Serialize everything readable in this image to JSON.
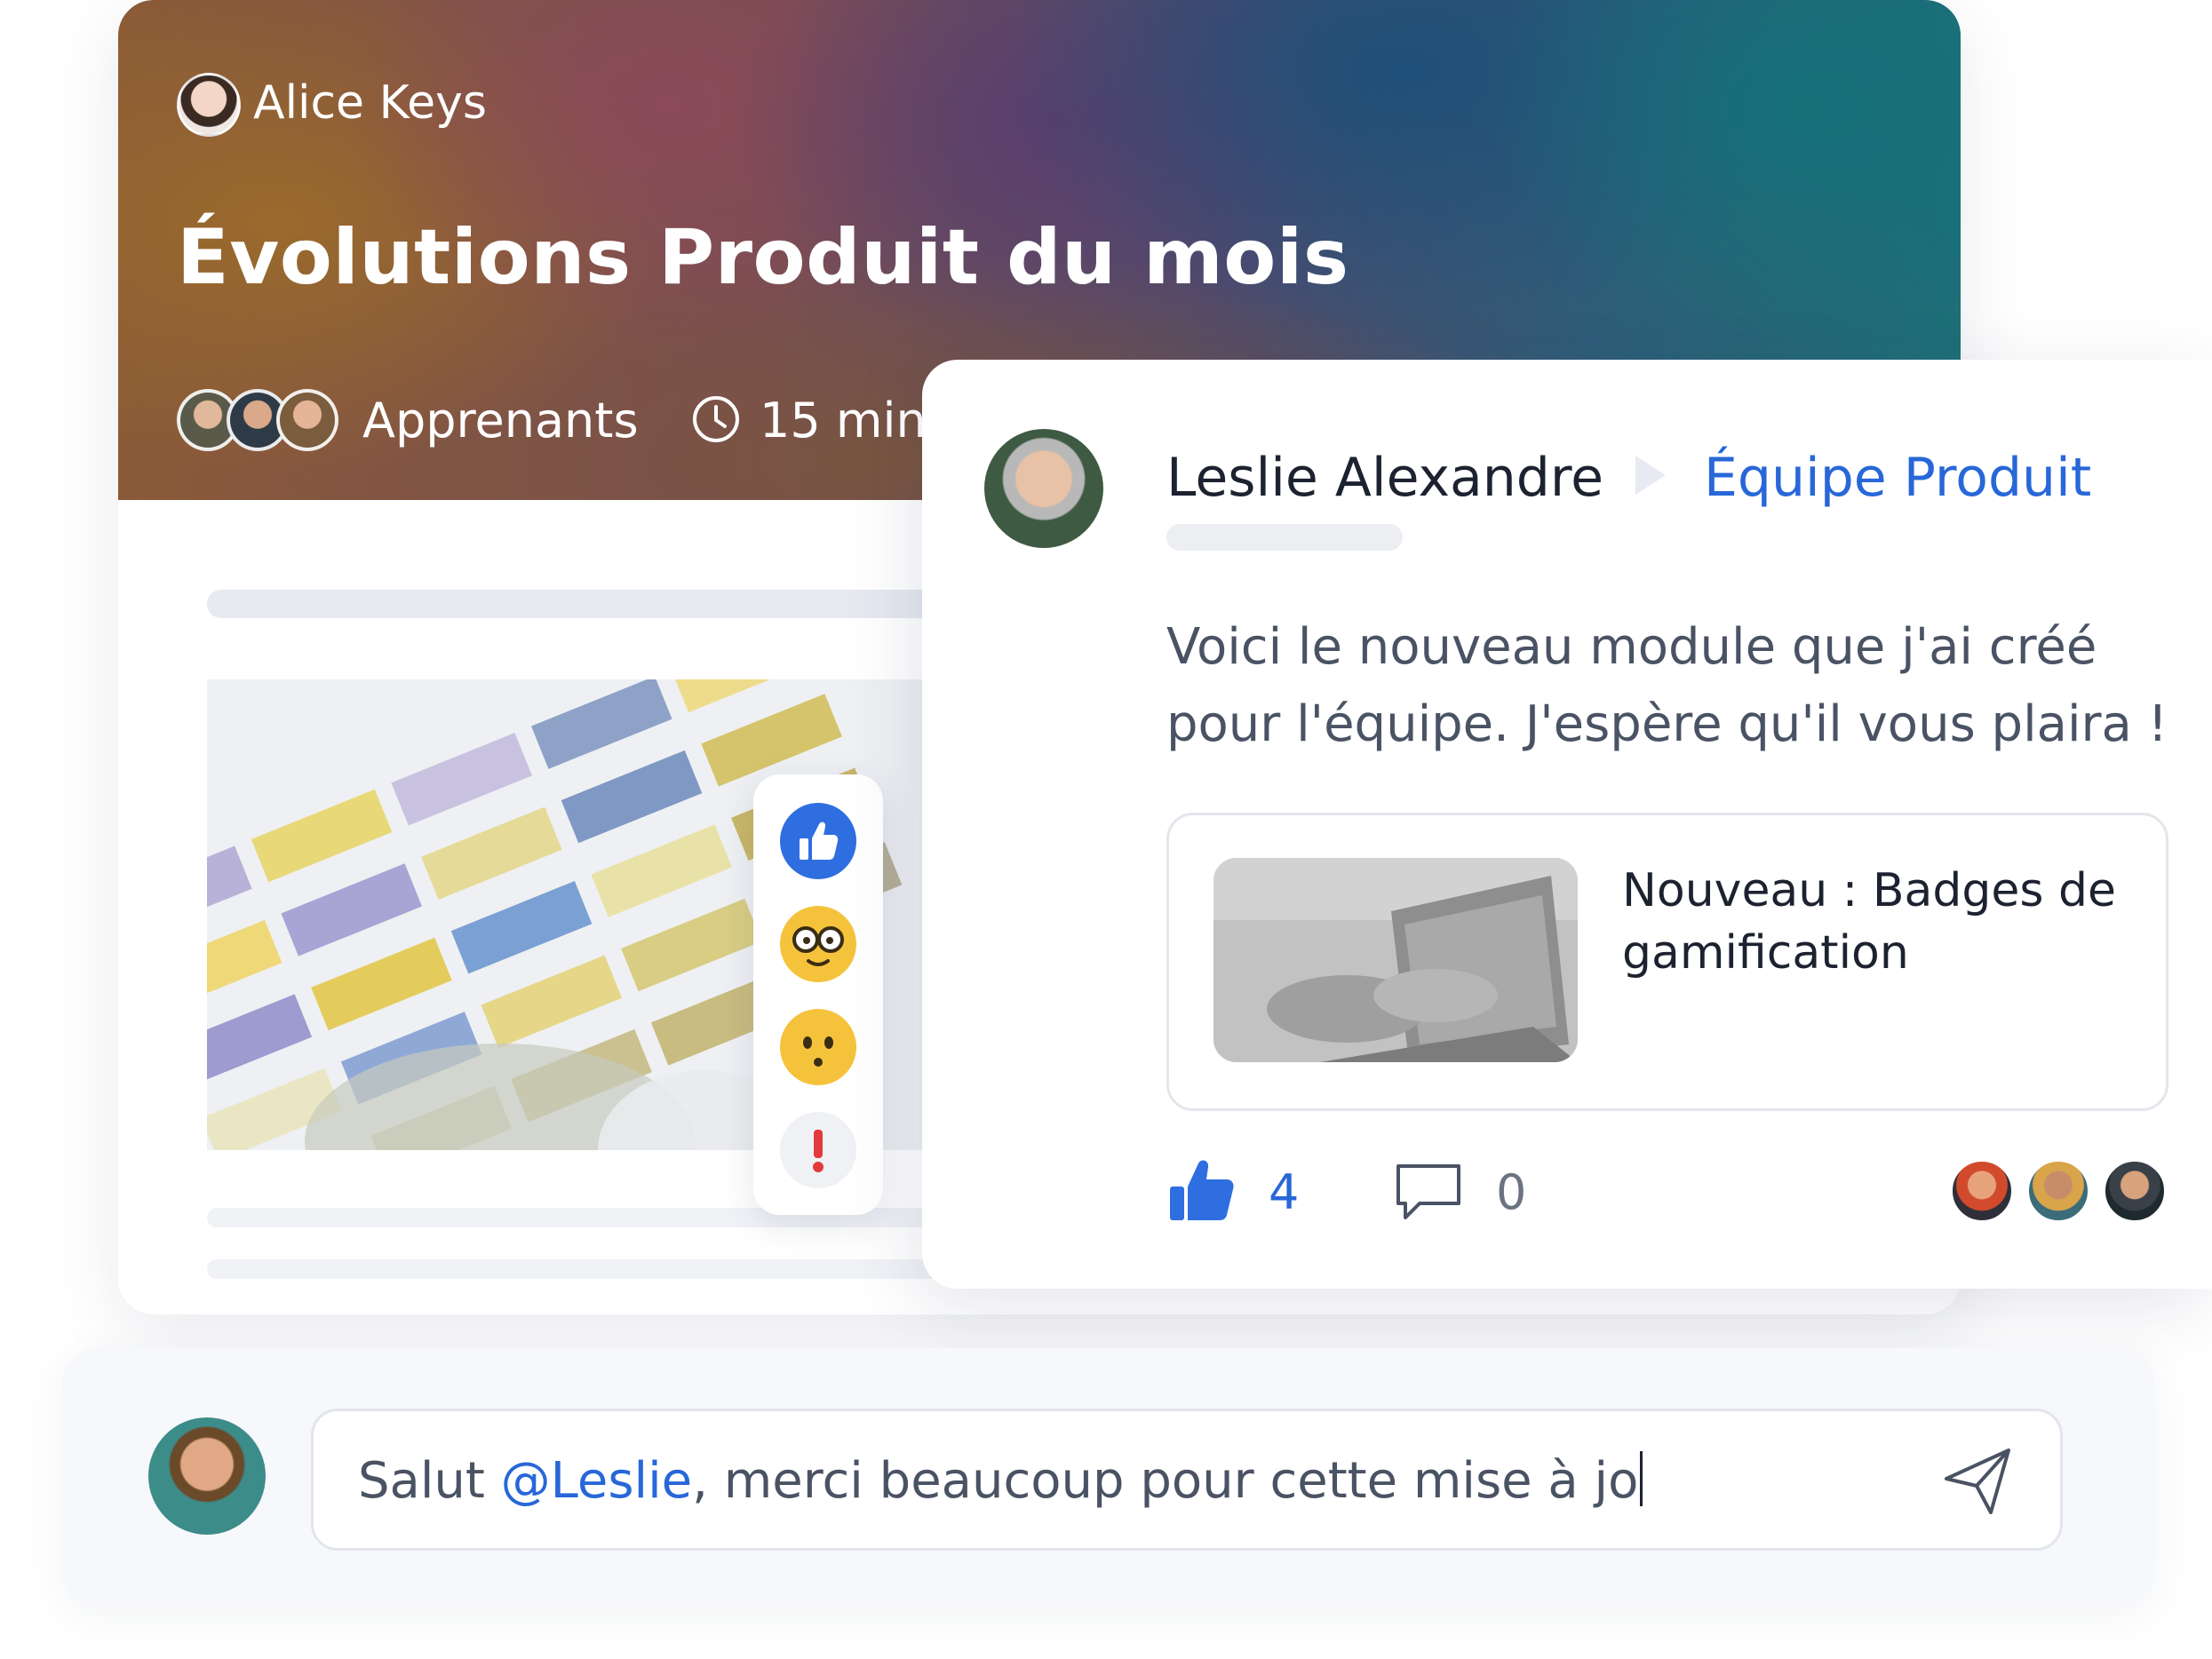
{
  "course": {
    "author": "Alice Keys",
    "title": "Évolutions Produit du mois",
    "learners_label": "Apprenants",
    "duration": "15 min"
  },
  "reactions": [
    "thumbs-up",
    "glasses-face",
    "hushed-face",
    "exclamation"
  ],
  "post": {
    "author": "Leslie Alexandre",
    "team": "Équipe Produit",
    "text": "Voici le nouveau module que j'ai créé pour l'équipe. J'espère qu'il vous plaira !",
    "link_title": "Nouveau : Badges de gamification",
    "likes": "4",
    "comments": "0"
  },
  "composer": {
    "text_before": "Salut ",
    "mention": "@Leslie",
    "text_after": ", merci beaucoup pour cette mise à jo"
  },
  "colors": {
    "accent": "#2867d8",
    "text": "#1d2230",
    "muted": "#4a5364"
  }
}
